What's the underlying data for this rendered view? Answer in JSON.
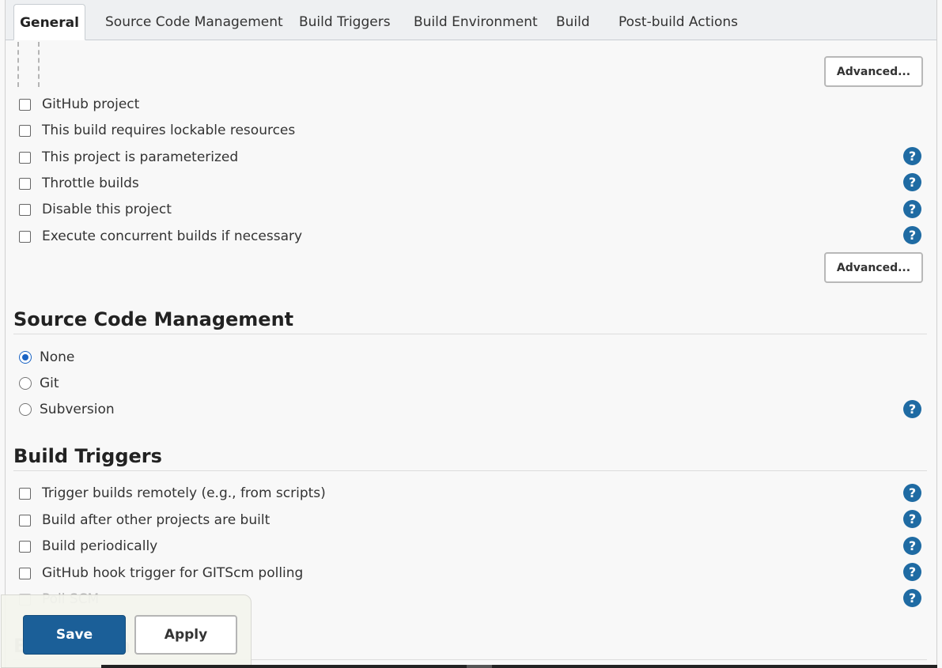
{
  "tabs": [
    {
      "label": "General",
      "active": true
    },
    {
      "label": "Source Code Management"
    },
    {
      "label": "Build Triggers"
    },
    {
      "label": "Build Environment"
    },
    {
      "label": "Build"
    },
    {
      "label": "Post-build Actions"
    }
  ],
  "general": {
    "advanced_label_1": "Advanced...",
    "advanced_label_2": "Advanced...",
    "options": [
      {
        "label": "GitHub project",
        "checked": false,
        "help": false
      },
      {
        "label": "This build requires lockable resources",
        "checked": false,
        "help": false
      },
      {
        "label": "This project is parameterized",
        "checked": false,
        "help": true
      },
      {
        "label": "Throttle builds",
        "checked": false,
        "help": true
      },
      {
        "label": "Disable this project",
        "checked": false,
        "help": true
      },
      {
        "label": "Execute concurrent builds if necessary",
        "checked": false,
        "help": true
      }
    ]
  },
  "scm": {
    "title": "Source Code Management",
    "options": [
      {
        "label": "None",
        "selected": true
      },
      {
        "label": "Git",
        "selected": false
      },
      {
        "label": "Subversion",
        "selected": false,
        "help": true
      }
    ]
  },
  "triggers": {
    "title": "Build Triggers",
    "options": [
      {
        "label": "Trigger builds remotely (e.g., from scripts)",
        "checked": false,
        "help": true
      },
      {
        "label": "Build after other projects are built",
        "checked": false,
        "help": true
      },
      {
        "label": "Build periodically",
        "checked": false,
        "help": true
      },
      {
        "label": "GitHub hook trigger for GITScm polling",
        "checked": false,
        "help": true
      },
      {
        "label": "Poll SCM",
        "checked": false,
        "help": true
      }
    ]
  },
  "next_section_title_partial": "B",
  "next_section_title_tail": "n",
  "help_glyph": "?",
  "actions": {
    "save_label": "Save",
    "apply_label": "Apply"
  },
  "colors": {
    "primary": "#1b5f98",
    "help": "#1f6ba3",
    "radio_selected": "#1b64c4"
  }
}
